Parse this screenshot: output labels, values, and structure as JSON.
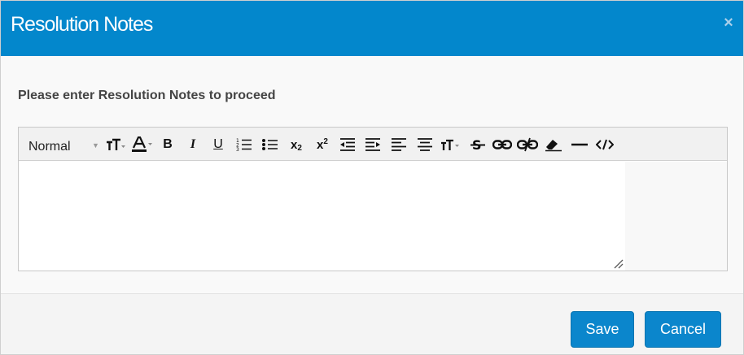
{
  "dialog": {
    "title": "Resolution Notes",
    "close_glyph": "×",
    "prompt": "Please enter Resolution Notes to proceed"
  },
  "toolbar": {
    "format_select": "Normal",
    "buttons": [
      {
        "icon": "font-size-icon"
      },
      {
        "icon": "font-color-icon"
      },
      {
        "icon": "bold-icon",
        "label": "B"
      },
      {
        "icon": "italic-icon",
        "label": "I"
      },
      {
        "icon": "underline-icon",
        "label": "U"
      },
      {
        "icon": "ordered-list-icon"
      },
      {
        "icon": "unordered-list-icon"
      },
      {
        "icon": "subscript-icon",
        "label": "x",
        "sub": "2"
      },
      {
        "icon": "superscript-icon",
        "label": "x",
        "sup": "2"
      },
      {
        "icon": "outdent-icon"
      },
      {
        "icon": "indent-icon"
      },
      {
        "icon": "align-left-icon"
      },
      {
        "icon": "align-center-icon"
      },
      {
        "icon": "line-height-icon"
      },
      {
        "icon": "strikethrough-icon"
      },
      {
        "icon": "link-icon"
      },
      {
        "icon": "unlink-icon"
      },
      {
        "icon": "clear-format-icon"
      },
      {
        "icon": "horizontal-rule-icon"
      },
      {
        "icon": "code-view-icon"
      }
    ]
  },
  "editor": {
    "value": "",
    "placeholder": ""
  },
  "footer": {
    "save_label": "Save",
    "cancel_label": "Cancel"
  },
  "colors": {
    "header": "#0387cc",
    "button": "#0b86cc"
  }
}
